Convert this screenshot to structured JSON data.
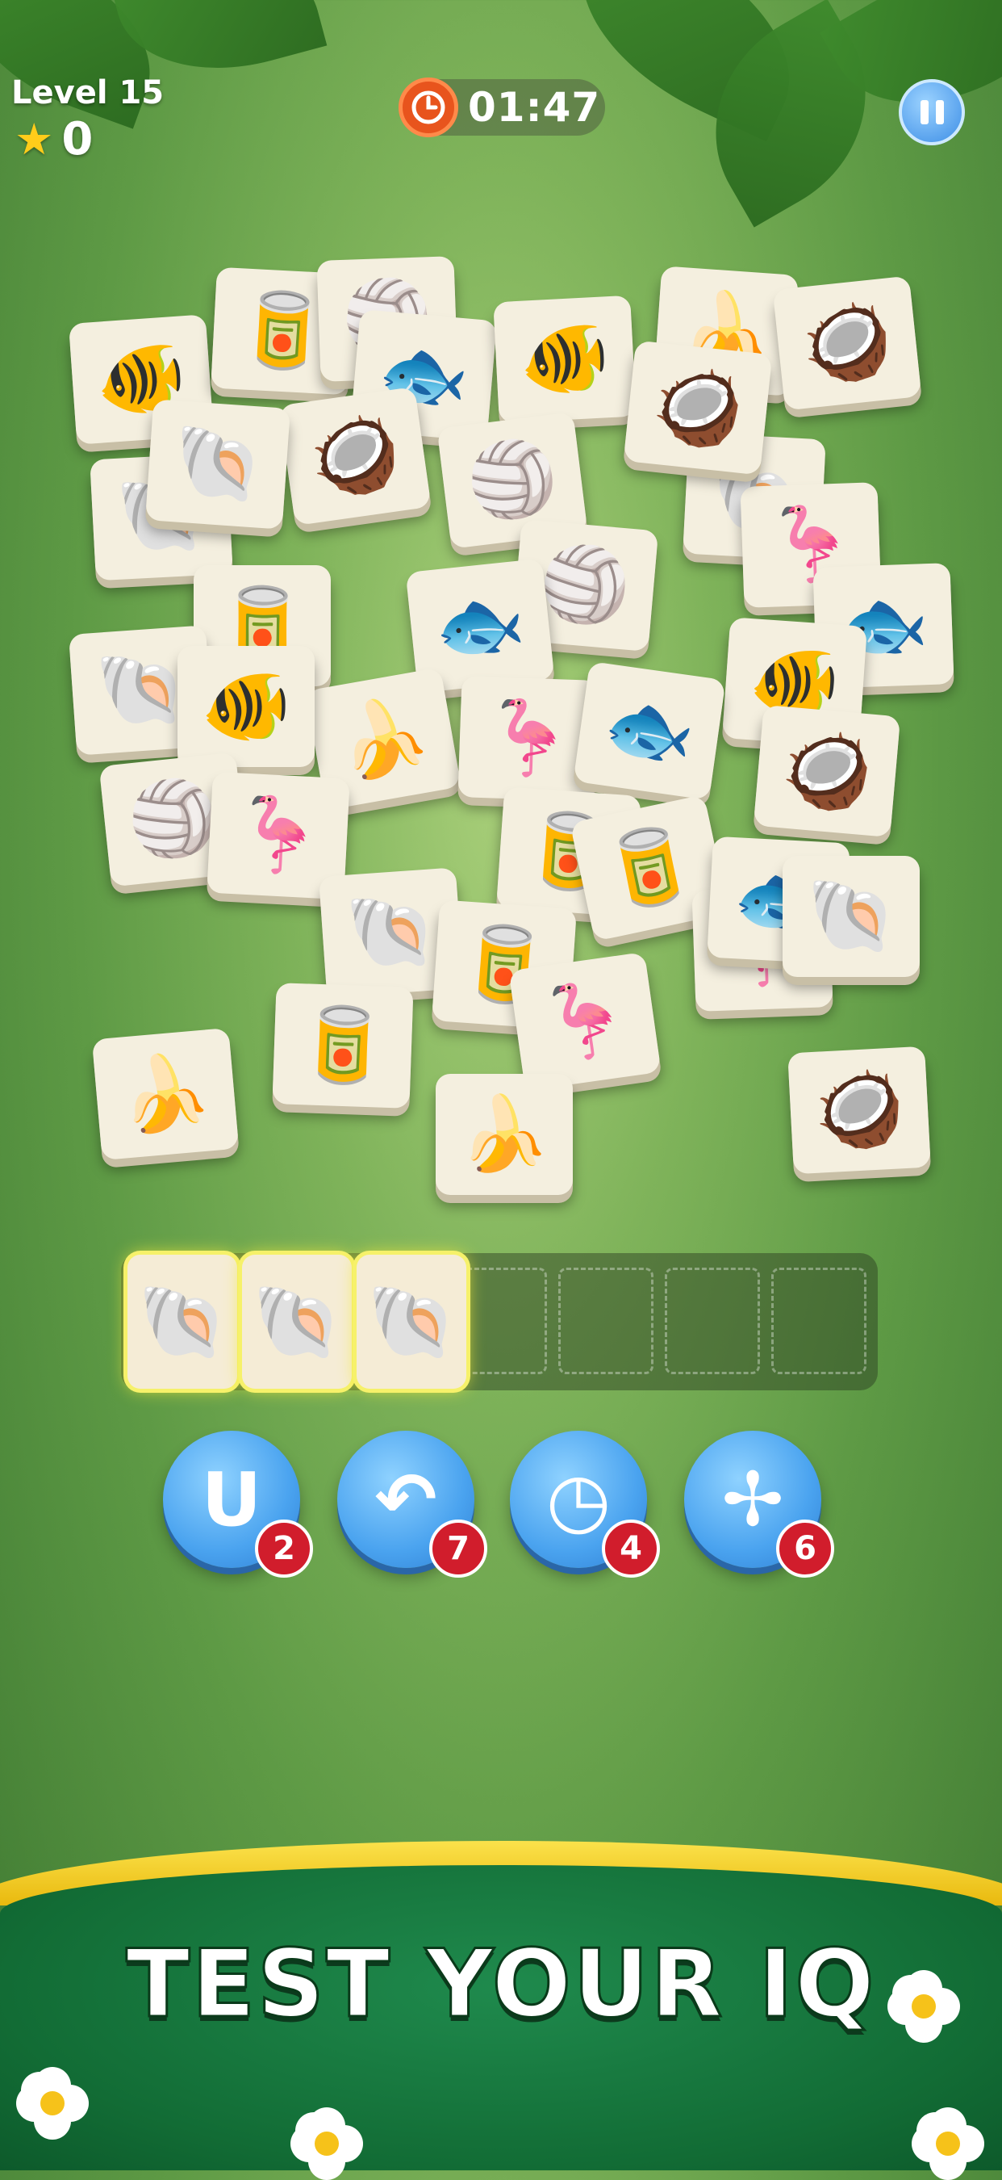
{
  "hud": {
    "level_label": "Level 15",
    "stars_count": "0",
    "timer": "01:47"
  },
  "icons": {
    "star": "star-icon",
    "clock": "clock-icon",
    "pause": "pause-icon"
  },
  "board_tiles": [
    {
      "item": "fish-yellow",
      "glyph": "🐠"
    },
    {
      "item": "soda-can-red",
      "glyph": "🥫"
    },
    {
      "item": "beach-ball",
      "glyph": "🏐"
    },
    {
      "item": "fish-blue",
      "glyph": "🐟"
    },
    {
      "item": "fish-yellow",
      "glyph": "🐠"
    },
    {
      "item": "banana",
      "glyph": "🍌"
    },
    {
      "item": "coconut-drink",
      "glyph": "🥥"
    },
    {
      "item": "clam-shell",
      "glyph": "🐚"
    },
    {
      "item": "coconut-drink",
      "glyph": "🥥"
    },
    {
      "item": "clam-shell",
      "glyph": "🐚"
    },
    {
      "item": "beach-ball",
      "glyph": "🏐"
    },
    {
      "item": "clam-shell",
      "glyph": "🐚"
    },
    {
      "item": "flamingo",
      "glyph": "🦩"
    },
    {
      "item": "soda-can-green",
      "glyph": "🥫"
    },
    {
      "item": "beach-ball",
      "glyph": "🏐"
    },
    {
      "item": "fish-blue",
      "glyph": "🐟"
    },
    {
      "item": "coconut-drink",
      "glyph": "🥥"
    },
    {
      "item": "fish-blue",
      "glyph": "🐟"
    },
    {
      "item": "fish-yellow",
      "glyph": "🐠"
    },
    {
      "item": "clam-shell",
      "glyph": "🐚"
    },
    {
      "item": "banana",
      "glyph": "🍌"
    },
    {
      "item": "flamingo",
      "glyph": "🦩"
    },
    {
      "item": "fish-blue",
      "glyph": "🐟"
    },
    {
      "item": "coconut-drink",
      "glyph": "🥥"
    },
    {
      "item": "fish-yellow",
      "glyph": "🐠"
    },
    {
      "item": "beach-ball",
      "glyph": "🏐"
    },
    {
      "item": "flamingo",
      "glyph": "🦩"
    },
    {
      "item": "soda-can-red",
      "glyph": "🥫"
    },
    {
      "item": "soda-can-red",
      "glyph": "🥫"
    },
    {
      "item": "clam-shell",
      "glyph": "🐚"
    },
    {
      "item": "soda-can-green",
      "glyph": "🥫"
    },
    {
      "item": "flamingo",
      "glyph": "🦩"
    },
    {
      "item": "fish-blue",
      "glyph": "🐟"
    },
    {
      "item": "clam-shell",
      "glyph": "🐚"
    },
    {
      "item": "soda-can-green",
      "glyph": "🥫"
    },
    {
      "item": "flamingo",
      "glyph": "🦩"
    },
    {
      "item": "banana",
      "glyph": "🍌"
    },
    {
      "item": "banana",
      "glyph": "🍌"
    },
    {
      "item": "coconut-drink",
      "glyph": "🥥"
    }
  ],
  "tray": {
    "filled": [
      {
        "item": "clam-shell",
        "glyph": "🐚"
      },
      {
        "item": "clam-shell",
        "glyph": "🐚"
      },
      {
        "item": "clam-shell",
        "glyph": "🐚"
      }
    ],
    "capacity": 7
  },
  "boosters": [
    {
      "name": "magnet",
      "icon": "magnet-icon",
      "glyph": "U",
      "count": "2"
    },
    {
      "name": "undo",
      "icon": "undo-icon",
      "glyph": "↶",
      "count": "7"
    },
    {
      "name": "time",
      "icon": "clock-icon",
      "glyph": "◷",
      "count": "4"
    },
    {
      "name": "shuffle",
      "icon": "fan-icon",
      "glyph": "✢",
      "count": "6"
    }
  ],
  "banner": {
    "text": "TEST YOUR IQ"
  },
  "colors": {
    "booster_blue": "#4aa3ef",
    "badge_red": "#d11d2c",
    "tray_highlight": "#f6f16a",
    "banner_green": "#126c35",
    "banner_gold": "#fbe24b"
  }
}
